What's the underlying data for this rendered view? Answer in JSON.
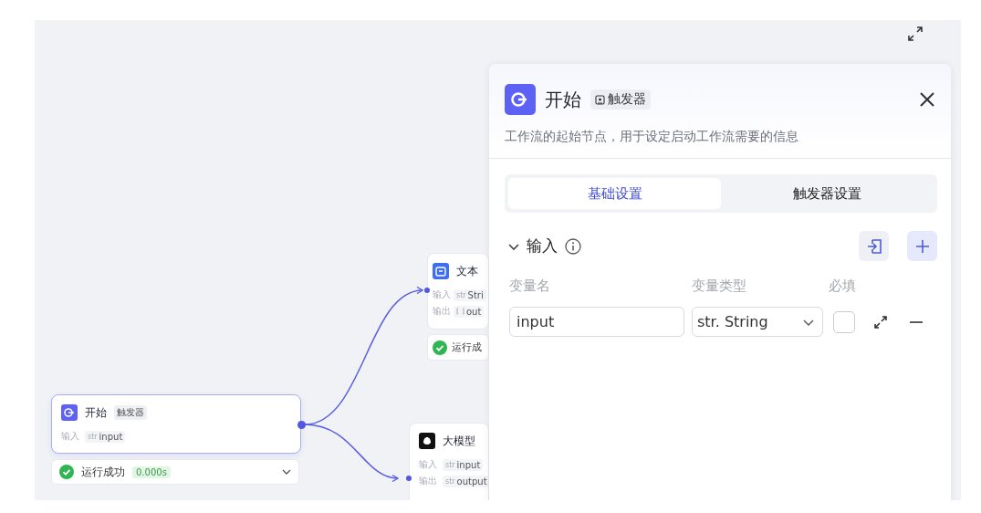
{
  "canvas": {
    "nodes": [
      {
        "kind": "start",
        "title": "开始",
        "tag": "触发器",
        "selected": true,
        "rows": [
          {
            "label": "输入",
            "kind": "str",
            "type": "str",
            "value": "input"
          }
        ],
        "status": {
          "text": "运行成功",
          "time": "0.000s",
          "expanded": false
        }
      },
      {
        "kind": "text",
        "title": "文本",
        "selected": false,
        "rows": [
          {
            "label": "输入",
            "kind": "str",
            "type": "str",
            "value": "Stri"
          },
          {
            "label": "输出",
            "kind": "array",
            "value": "out"
          }
        ],
        "status": {
          "text": "运行成"
        }
      },
      {
        "kind": "llm",
        "title": "大模型",
        "selected": false,
        "rows": [
          {
            "label": "输入",
            "kind": "str",
            "type": "str",
            "value": "input"
          },
          {
            "label": "输出",
            "kind": "str",
            "type": "str",
            "value": "output"
          }
        ]
      }
    ]
  },
  "panel": {
    "title": "开始",
    "tag": "触发器",
    "description": "工作流的起始节点，用于设定启动工作流需要的信息",
    "tabs": [
      {
        "label": "基础设置",
        "selected": true
      },
      {
        "label": "触发器设置",
        "selected": false
      }
    ],
    "section": {
      "title": "输入",
      "expanded": true,
      "columns": [
        "变量名",
        "变量类型",
        "必填"
      ],
      "rows": [
        {
          "name": "input",
          "type": "str. String",
          "required": false
        }
      ]
    }
  }
}
